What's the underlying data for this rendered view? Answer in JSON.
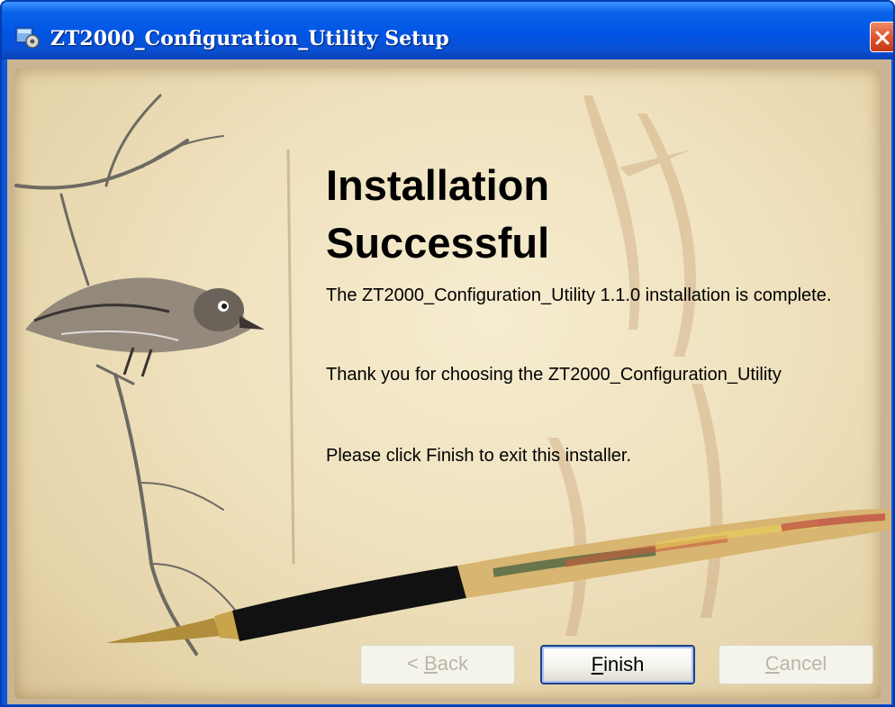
{
  "window": {
    "title": "ZT2000_Configuration_Utility Setup"
  },
  "content": {
    "heading_line1": "Installation",
    "heading_line2": "Successful",
    "paragraph1": "The ZT2000_Configuration_Utility 1.1.0 installation is complete.",
    "paragraph2": "Thank you for choosing the ZT2000_Configuration_Utility",
    "paragraph3": "Please click Finish to exit this installer."
  },
  "buttons": {
    "back_prefix": "< ",
    "back_mnemonic": "B",
    "back_rest": "ack",
    "finish_mnemonic": "F",
    "finish_rest": "inish",
    "cancel_mnemonic": "C",
    "cancel_rest": "ancel"
  },
  "state": {
    "back_enabled": false,
    "finish_enabled": true,
    "cancel_enabled": false
  },
  "icons": {
    "app": "installer-icon",
    "close": "close-icon"
  },
  "colors": {
    "titlebar": "#0055e5",
    "close_button": "#e0552f",
    "paper": "#efe1bd"
  }
}
